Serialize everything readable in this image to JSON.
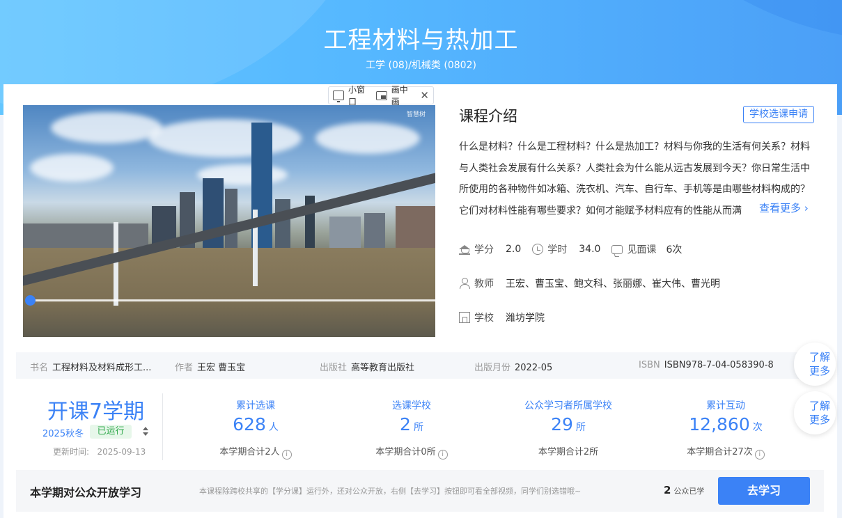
{
  "course": {
    "title": "工程材料与热加工",
    "category": "工学 (08)/机械类 (0802)"
  },
  "player": {
    "mini_window_label": "小窗口",
    "pip_label": "画中画",
    "close_symbol": "✕",
    "watermark": "智慧树",
    "progress": 0.0
  },
  "intro": {
    "title": "课程介绍",
    "apply_label": "学校选课申请",
    "text": "什么是材料？什么是工程材料？什么是热加工？材料与你我的生活有何关系？材料与人类社会发展有什么关系？人类社会为什么能从远古发展到今天？你日常生活中所使用的各种物件如冰箱、洗衣机、汽车、自行车、手机等是由哪些材料构成的？它们对材料性能有哪些要求？如何才能赋予材料应有的性能从而满",
    "more_label": "查看更多"
  },
  "meta": {
    "credit_label": "学分",
    "credit_value": "2.0",
    "hours_label": "学时",
    "hours_value": "34.0",
    "meet_label": "见面课",
    "meet_value": "6次",
    "teacher_label": "教师",
    "teacher_value": "王宏、曹玉宝、鲍文科、张丽娜、崔大伟、曹光明",
    "school_label": "学校",
    "school_value": "潍坊学院"
  },
  "book": {
    "name_label": "书名",
    "name_value": "工程材料及材料成形工...",
    "author_label": "作者",
    "author_value": "王宏 曹玉宝",
    "publisher_label": "出版社",
    "publisher_value": "高等教育出版社",
    "month_label": "出版月份",
    "month_value": "2022-05",
    "isbn_label": "ISBN",
    "isbn_value": "ISBN978-7-04-058390-8"
  },
  "side": {
    "learn_more_1": "了解更多",
    "learn_more_2": "了解更多"
  },
  "semester": {
    "title": "开课7学期",
    "term": "2025秋冬",
    "status": "已运行",
    "update_label": "更新时间:",
    "update_value": "2025-09-13"
  },
  "stats": [
    {
      "label": "累计选课",
      "value": "628",
      "unit": "人",
      "sub": "本学期合计2人"
    },
    {
      "label": "选课学校",
      "value": "2",
      "unit": "所",
      "sub": "本学期合计0所"
    },
    {
      "label": "公众学习者所属学校",
      "value": "29",
      "unit": "所",
      "sub": "本学期合计2所"
    },
    {
      "label": "累计互动",
      "value": "12,860",
      "unit": "次",
      "sub": "本学期合计27次"
    }
  ],
  "bottom": {
    "title": "本学期对公众开放学习",
    "desc": "本课程除跨校共享的【学分课】运行外，还对公众开放，右侧【去学习】按钮即可看全部视频，同学们别选错哦~",
    "count_value": "2",
    "count_label": "公众已学",
    "go_label": "去学习"
  },
  "colors": {
    "accent": "#3b82f6",
    "hero_start": "#63c6ff",
    "hero_end": "#4b9ff7",
    "success": "#2ea84a"
  }
}
